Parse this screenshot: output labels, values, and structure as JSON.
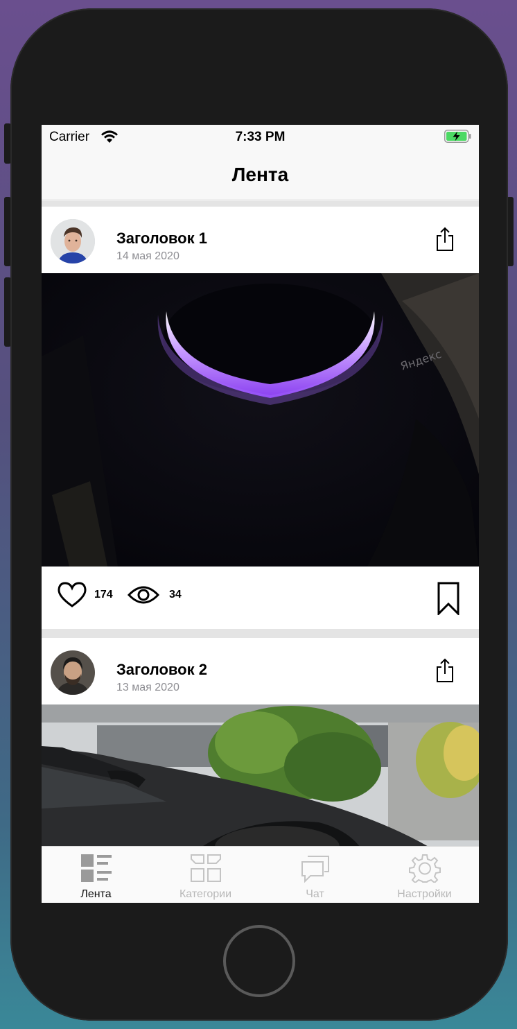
{
  "status_bar": {
    "carrier": "Carrier",
    "time": "7:33 PM"
  },
  "nav": {
    "title": "Лента"
  },
  "posts": [
    {
      "title": "Заголовок 1",
      "date": "14 мая 2020",
      "likes": "174",
      "views": "34",
      "image_brand_text": "Яндекс"
    },
    {
      "title": "Заголовок 2",
      "date": "13 мая 2020"
    }
  ],
  "tabs": [
    {
      "label": "Лента",
      "icon": "feed-icon",
      "active": true
    },
    {
      "label": "Категории",
      "icon": "categories-icon",
      "active": false
    },
    {
      "label": "Чат",
      "icon": "chat-icon",
      "active": false
    },
    {
      "label": "Настройки",
      "icon": "settings-icon",
      "active": false
    }
  ],
  "colors": {
    "active_tab": "#111111",
    "inactive_tab": "#b8b8b8",
    "date_text": "#8e8e93",
    "battery_fill": "#4cd964",
    "glow": "#a66cff"
  }
}
